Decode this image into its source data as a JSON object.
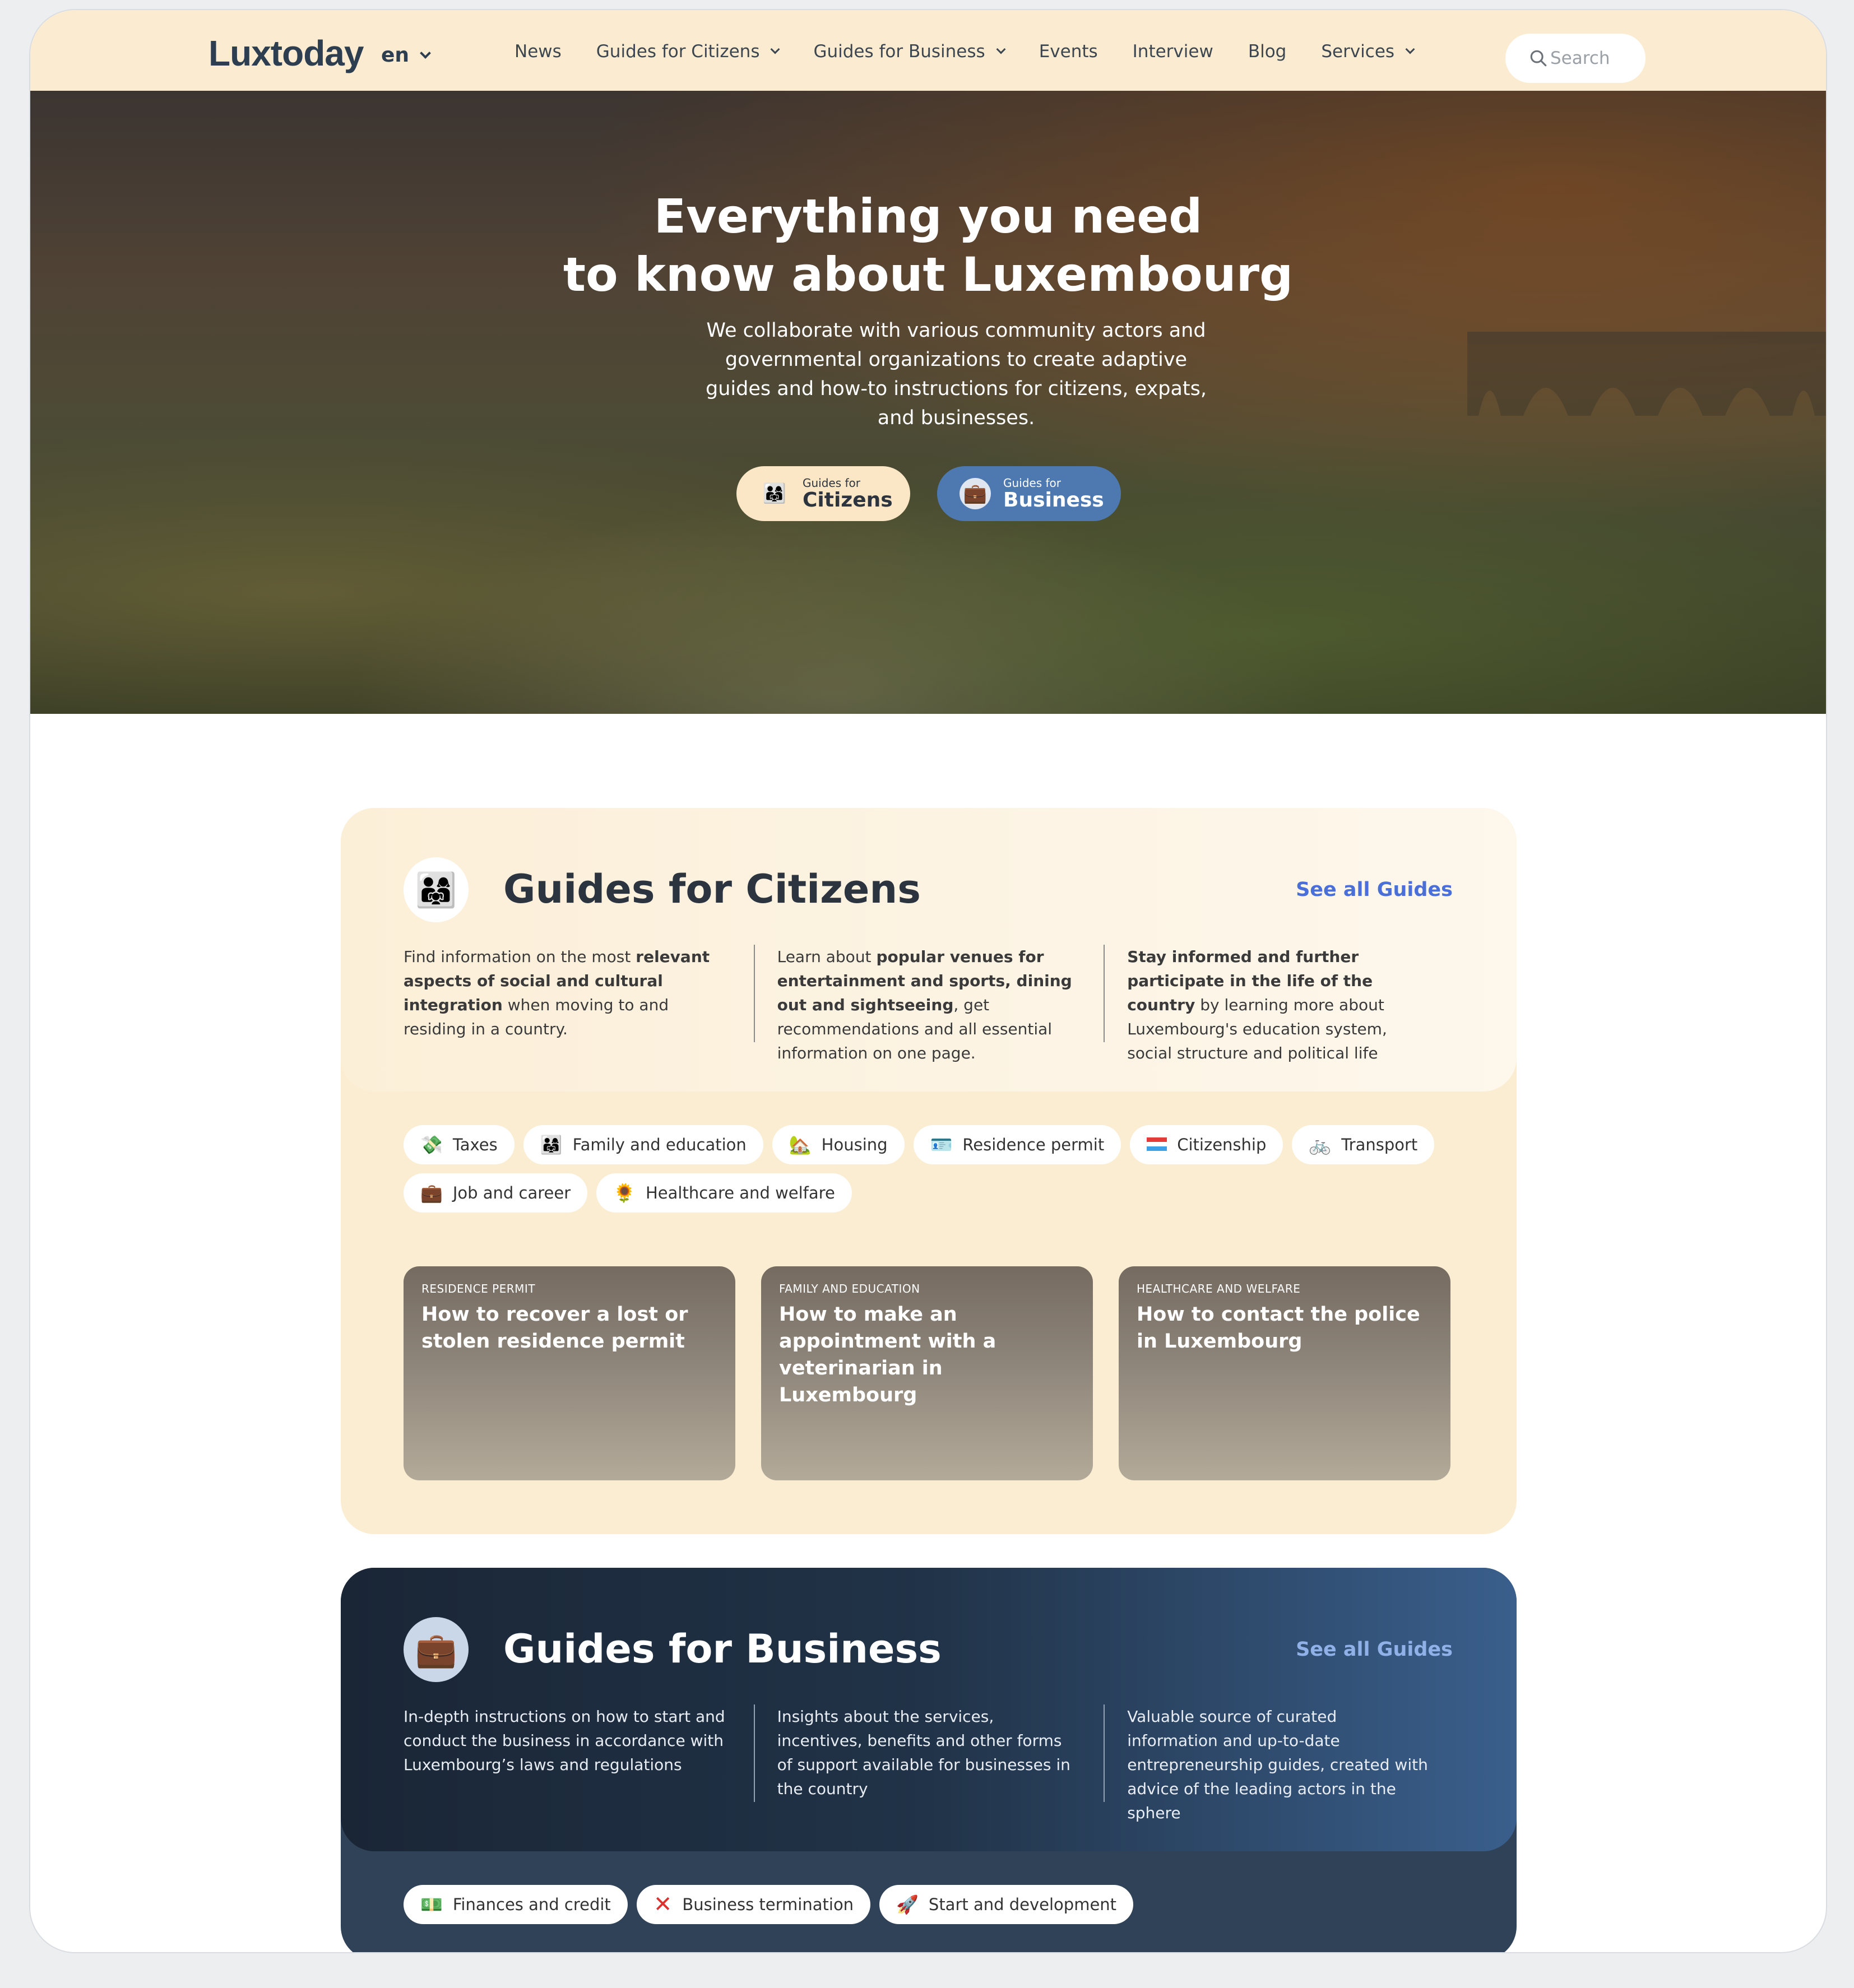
{
  "header": {
    "logo": "Luxtoday",
    "language": "en",
    "nav": [
      {
        "label": "News",
        "dropdown": false
      },
      {
        "label": "Guides for Citizens",
        "dropdown": true
      },
      {
        "label": "Guides for Business",
        "dropdown": true
      },
      {
        "label": "Events",
        "dropdown": false
      },
      {
        "label": "Interview",
        "dropdown": false
      },
      {
        "label": "Blog",
        "dropdown": false
      },
      {
        "label": "Services",
        "dropdown": true
      }
    ],
    "search_placeholder": "Search"
  },
  "hero": {
    "title_line1": "Everything you need",
    "title_line2": "to know about Luxembourg",
    "subtitle": "We collaborate with various community actors and governmental organizations to create adaptive guides and how-to instructions for citizens, expats, and businesses.",
    "button_citizens": {
      "small": "Guides for",
      "big": "Citizens",
      "icon": "family-icon"
    },
    "button_business": {
      "small": "Guides for",
      "big": "Business",
      "icon": "briefcase-icon"
    }
  },
  "citizens": {
    "title": "Guides for Citizens",
    "see_all": "See all Guides",
    "icon": "family-icon",
    "tags": [
      {
        "label": "Taxes",
        "icon": "money-icon",
        "glyph": "💸"
      },
      {
        "label": "Family and education",
        "icon": "family-icon",
        "glyph": "👨‍👩‍👧"
      },
      {
        "label": "Housing",
        "icon": "house-icon",
        "glyph": "🏡"
      },
      {
        "label": "Residence permit",
        "icon": "id-card-icon",
        "glyph": "🪪"
      },
      {
        "label": "Citizenship",
        "icon": "flag-icon",
        "glyph": "🇱🇺"
      },
      {
        "label": "Transport",
        "icon": "bicycle-icon",
        "glyph": "🚲"
      },
      {
        "label": "Job and career",
        "icon": "briefcase-icon",
        "glyph": "💼"
      },
      {
        "label": "Healthcare and welfare",
        "icon": "health-icon",
        "glyph": "🌻"
      }
    ],
    "cards": [
      {
        "category": "Residence permit",
        "title": "How to recover a lost or stolen residence permit"
      },
      {
        "category": "Family and education",
        "title": "How to make an appointment with a veterinarian in Luxembourg"
      },
      {
        "category": "Healthcare and welfare",
        "title": "How to contact the police in Luxembourg"
      }
    ]
  },
  "business": {
    "title": "Guides for Business",
    "see_all": "See all Guides",
    "icon": "briefcase-icon",
    "col1": "In-depth instructions on how to start and conduct the business in accordance with Luxembourg’s laws and regulations",
    "col2": "Insights about the services, incentives, benefits and other forms of support available for businesses in the country",
    "col3": "Valuable source of curated information and up-to-date entrepreneurship guides, created with advice of the leading actors in the sphere",
    "tags": [
      {
        "label": "Finances and credit",
        "icon": "money-icon",
        "glyph": "💵"
      },
      {
        "label": "Business termination",
        "icon": "cross-icon",
        "glyph": "❌"
      },
      {
        "label": "Start and development",
        "icon": "rocket-icon",
        "glyph": "🚀"
      }
    ]
  },
  "colors": {
    "header_bg": "#fbebd0",
    "accent_blue": "#4a6fd8",
    "business_btn": "#4e79b0",
    "citizens_section": "#fbedd2",
    "business_section": "#1a2636"
  }
}
